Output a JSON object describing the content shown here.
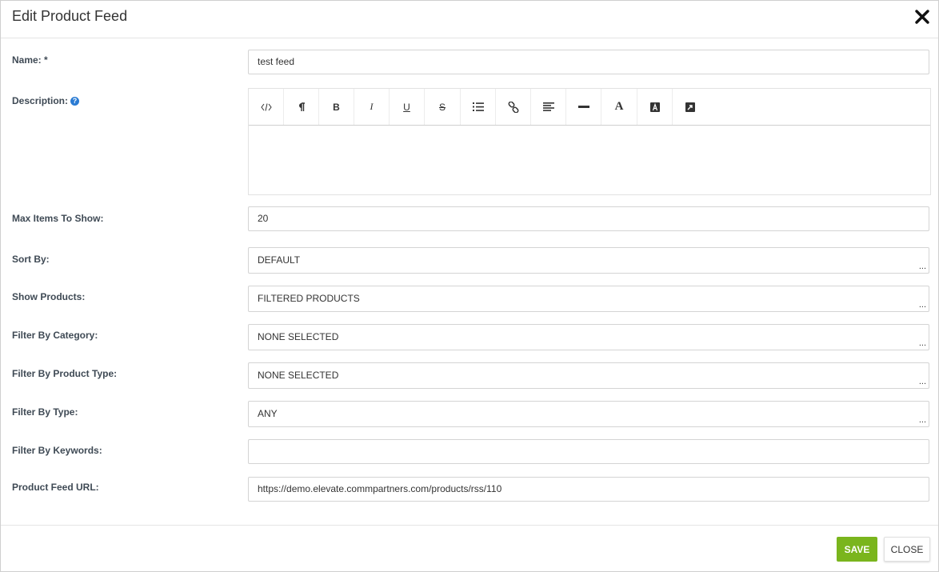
{
  "modal": {
    "title": "Edit Product Feed",
    "close_icon": "close-icon"
  },
  "form": {
    "name": {
      "label": "Name: *",
      "value": "test feed"
    },
    "description": {
      "label": "Description:",
      "help_icon": "question-circle-icon",
      "value": "",
      "toolbar": [
        {
          "name": "code-view-icon",
          "glyph": "</>"
        },
        {
          "name": "paragraph-icon",
          "glyph": "¶"
        },
        {
          "name": "bold-icon",
          "glyph": "B"
        },
        {
          "name": "italic-icon",
          "glyph": "I"
        },
        {
          "name": "underline-icon",
          "glyph": "U"
        },
        {
          "name": "strikethrough-icon",
          "glyph": "S"
        },
        {
          "name": "unordered-list-icon",
          "glyph": "list"
        },
        {
          "name": "link-icon",
          "glyph": "link"
        },
        {
          "name": "align-left-icon",
          "glyph": "align"
        },
        {
          "name": "horizontal-rule-icon",
          "glyph": "hr"
        },
        {
          "name": "font-size-icon",
          "glyph": "A"
        },
        {
          "name": "font-color-icon",
          "glyph": "A"
        },
        {
          "name": "insert-image-icon",
          "glyph": "img"
        }
      ]
    },
    "max_items": {
      "label": "Max Items To Show:",
      "value": "20"
    },
    "sort_by": {
      "label": "Sort By:",
      "value": "DEFAULT"
    },
    "show_products": {
      "label": "Show Products:",
      "value": "FILTERED PRODUCTS"
    },
    "filter_category": {
      "label": "Filter By Category:",
      "value": "NONE SELECTED"
    },
    "filter_product_type": {
      "label": "Filter By Product Type:",
      "value": "NONE SELECTED"
    },
    "filter_type": {
      "label": "Filter By Type:",
      "value": "ANY"
    },
    "filter_keywords": {
      "label": "Filter By Keywords:",
      "value": ""
    },
    "feed_url": {
      "label": "Product Feed URL:",
      "value": "https://demo.elevate.commpartners.com/products/rss/110"
    },
    "select_more": "..."
  },
  "footer": {
    "save_label": "SAVE",
    "close_label": "CLOSE"
  },
  "colors": {
    "save_button": "#7ab51d",
    "help_icon": "#2a7bd3"
  }
}
